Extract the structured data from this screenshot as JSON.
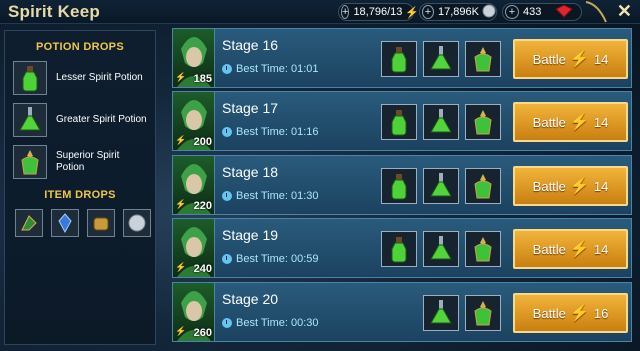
{
  "header": {
    "title": "Spirit Keep",
    "resources": [
      {
        "value": "18,796/13",
        "icon": "energy-bolt-icon"
      },
      {
        "value": "17,896K",
        "icon": "silver-coin-icon"
      },
      {
        "value": "433",
        "icon": "gem-icon"
      }
    ],
    "close_label": "✕"
  },
  "sidebar": {
    "potion_heading": "POTION DROPS",
    "potions": [
      {
        "label": "Lesser Spirit Potion",
        "icon": "lesser-spirit-potion-icon"
      },
      {
        "label": "Greater Spirit Potion",
        "icon": "greater-spirit-potion-icon"
      },
      {
        "label": "Superior Spirit Potion",
        "icon": "superior-spirit-potion-icon"
      }
    ],
    "item_heading": "ITEM DROPS",
    "items": [
      "artifact-gauntlet-icon",
      "blue-shard-icon",
      "bread-icon",
      "silver-coin-icon"
    ]
  },
  "stages": [
    {
      "name": "Stage 16",
      "best_time": "Best Time: 01:01",
      "level": "185",
      "battle_label": "Battle",
      "energy": "14",
      "drops": [
        "lesser",
        "greater",
        "superior"
      ]
    },
    {
      "name": "Stage 17",
      "best_time": "Best Time: 01:16",
      "level": "200",
      "battle_label": "Battle",
      "energy": "14",
      "drops": [
        "lesser",
        "greater",
        "superior"
      ]
    },
    {
      "name": "Stage 18",
      "best_time": "Best Time: 01:30",
      "level": "220",
      "battle_label": "Battle",
      "energy": "14",
      "drops": [
        "lesser",
        "greater",
        "superior"
      ]
    },
    {
      "name": "Stage 19",
      "best_time": "Best Time: 00:59",
      "level": "240",
      "battle_label": "Battle",
      "energy": "14",
      "drops": [
        "lesser",
        "greater",
        "superior"
      ]
    },
    {
      "name": "Stage 20",
      "best_time": "Best Time: 00:30",
      "level": "260",
      "battle_label": "Battle",
      "energy": "16",
      "drops": [
        "greater",
        "superior"
      ]
    }
  ],
  "colors": {
    "accent_gold": "#f0c64a",
    "battle_button": "#e09b22",
    "row_bg": "#245070"
  }
}
